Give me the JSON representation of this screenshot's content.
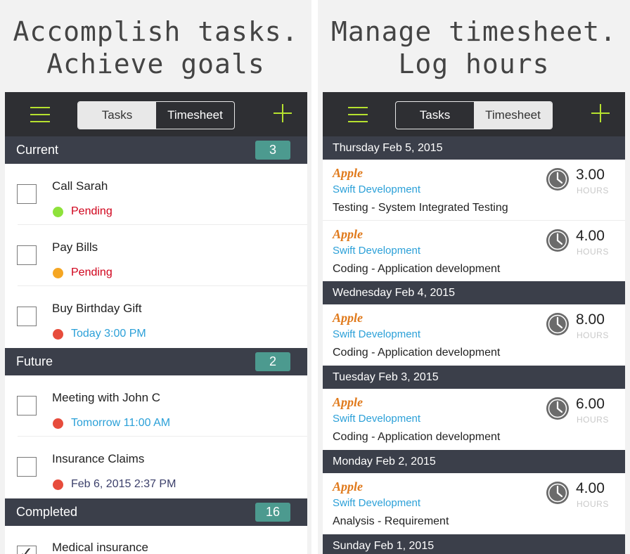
{
  "left": {
    "headline": [
      "Accomplish tasks.",
      "Achieve goals"
    ],
    "tabs": [
      "Tasks",
      "Timesheet"
    ],
    "active_tab": "Tasks",
    "sections": [
      {
        "title": "Current",
        "count": "3"
      },
      {
        "title": "Future",
        "count": "2"
      },
      {
        "title": "Completed",
        "count": "16"
      }
    ],
    "tasks": [
      {
        "title": "Call Sarah",
        "status": "Pending",
        "dot_color": "#8ee23b",
        "status_color": "#d0021b"
      },
      {
        "title": "Pay Bills",
        "status": "Pending",
        "dot_color": "#f5a623",
        "status_color": "#d0021b"
      },
      {
        "title": "Buy Birthday Gift",
        "status": "Today 3:00 PM",
        "dot_color": "#e74c3c",
        "status_color": "#2ba0d8"
      },
      {
        "title": "Meeting with John C",
        "status": "Tomorrow 11:00 AM",
        "dot_color": "#e74c3c",
        "status_color": "#2ba0d8"
      },
      {
        "title": "Insurance Claims",
        "status": "Feb 6, 2015 2:37 PM",
        "dot_color": "#e74c3c",
        "status_color": "#3b3f6a"
      },
      {
        "title": "Medical insurance",
        "status": "",
        "dot_color": "",
        "status_color": "#222222"
      }
    ]
  },
  "right": {
    "headline": [
      "Manage timesheet.",
      "Log hours"
    ],
    "tabs": [
      "Tasks",
      "Timesheet"
    ],
    "active_tab": "Timesheet",
    "days": [
      "Thursday Feb 5, 2015",
      "Wednesday Feb 4, 2015",
      "Tuesday Feb 3, 2015",
      "Monday Feb 2, 2015",
      "Sunday Feb 1, 2015"
    ],
    "entries": [
      {
        "client": "Apple",
        "project": "Swift Development",
        "description": "Testing - System Integrated Testing",
        "hours": "3.00",
        "unit": "HOURS"
      },
      {
        "client": "Apple",
        "project": "Swift Development",
        "description": "Coding - Application development",
        "hours": "4.00",
        "unit": "HOURS"
      },
      {
        "client": "Apple",
        "project": "Swift Development",
        "description": "Coding - Application development",
        "hours": "8.00",
        "unit": "HOURS"
      },
      {
        "client": "Apple",
        "project": "Swift Development",
        "description": "Coding - Application development",
        "hours": "6.00",
        "unit": "HOURS"
      },
      {
        "client": "Apple",
        "project": "Swift Development",
        "description": "Analysis - Requirement",
        "hours": "4.00",
        "unit": "HOURS"
      }
    ]
  },
  "colors": {
    "accent": "#b6e12f",
    "navbar": "#2e2f33",
    "section": "#3b3f4a",
    "badge": "#4c9a8f",
    "client": "#e07a1c",
    "project": "#2ba0d8"
  }
}
